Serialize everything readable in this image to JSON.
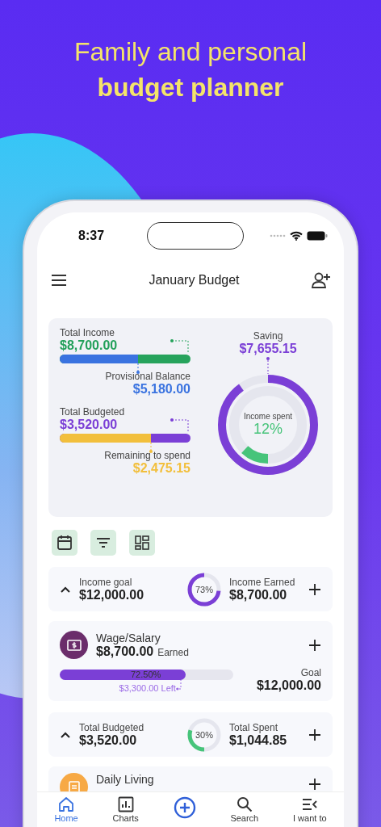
{
  "headline": {
    "line_1": "Family and personal",
    "line_2": "budget planner"
  },
  "status_bar": {
    "time": "8:37"
  },
  "app_bar": {
    "title": "January Budget"
  },
  "summary": {
    "total_income": {
      "label": "Total Income",
      "value": "$8,700.00"
    },
    "income_bar": {
      "level": 0.6
    },
    "provisional_balance": {
      "label": "Provisional Balance",
      "value": "$5,180.00"
    },
    "total_budgeted": {
      "label": "Total Budgeted",
      "value": "$3,520.00"
    },
    "budget_bar": {
      "level": 0.7
    },
    "remaining": {
      "label": "Remaining to spend",
      "value": "$2,475.15"
    },
    "saving": {
      "label": "Saving",
      "value": "$7,655.15",
      "level": 0.9
    },
    "income_spent": {
      "label": "Income spent",
      "value": "12%",
      "level": 0.12
    }
  },
  "income_goal_row": {
    "label": "Income goal",
    "value": "$12,000.00",
    "ring_label": "73%",
    "level": 0.73,
    "earned_label": "Income Earned",
    "earned_value": "$8,700.00"
  },
  "categories": [
    {
      "name": "Wage/Salary",
      "value": "$8,700.00",
      "suffix": "Earned",
      "bar_label": "72.50%",
      "level": 0.725,
      "left": "$3,300.00 Left",
      "goal_label": "Goal",
      "goal_value": "$12,000.00",
      "color": "#6b2d6b"
    }
  ],
  "budget_row": {
    "label": "Total Budgeted",
    "value": "$3,520.00",
    "ring_label": "30%",
    "level": 0.3,
    "spent_label": "Total Spent",
    "spent_value": "$1,044.85"
  },
  "partial_category": {
    "name": "Daily Living",
    "color": "#f7a945"
  },
  "bottom_nav": [
    {
      "kind": "home",
      "label": "Home",
      "selected": true
    },
    {
      "kind": "charts",
      "label": "Charts",
      "selected": false
    },
    {
      "kind": "add"
    },
    {
      "kind": "search",
      "label": "Search",
      "selected": false
    },
    {
      "kind": "more",
      "label": "I want to",
      "selected": false
    }
  ]
}
